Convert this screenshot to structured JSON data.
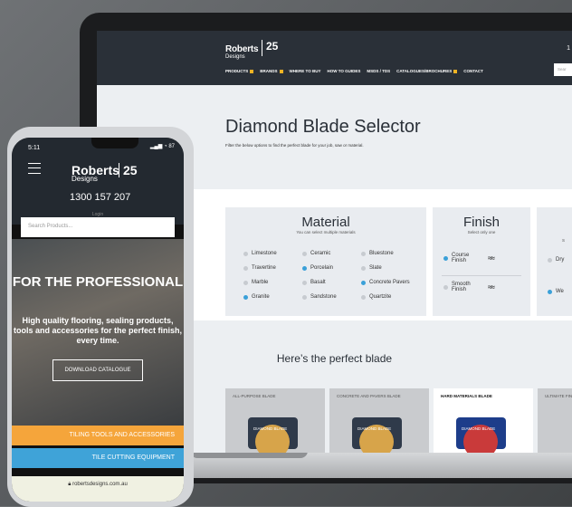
{
  "laptop": {
    "header": {
      "brand": "Roberts",
      "brand_sub": "Designs",
      "years": "25",
      "nav": [
        "PRODUCTS",
        "BRANDS",
        "WHERE TO BUY",
        "HOW TO GUIDES",
        "MSDS / TDS",
        "CATALOGUES/BROCHURES",
        "CONTACT"
      ],
      "search_placeholder": "Sear",
      "phone": "1"
    },
    "page_title": "Diamond Blade Selector",
    "page_subtitle": "Filter the below options to find the perfect blade for your job, saw or material.",
    "material": {
      "title": "Material",
      "hint": "You can select multiple materials",
      "options": [
        "Limestone",
        "Ceramic",
        "Bluestone",
        "Travertine",
        "Porcelain",
        "Slate",
        "Marble",
        "Basalt",
        "Concrete Pavers",
        "Granite",
        "Sandstone",
        "Quartzite"
      ]
    },
    "finish": {
      "title": "Finish",
      "hint": "Select only one",
      "options": [
        "Course Finish",
        "Smooth Finish"
      ]
    },
    "condition": {
      "hint": "S",
      "options": [
        "Dry",
        "We"
      ]
    },
    "results_title": "Here’s the perfect blade",
    "results": [
      "ALL-PURPOSE BLADE",
      "CONCRETE AND PAVERS BLADE",
      "HARD MATERIALS BLADE",
      "ULTIMATE FINISH BL"
    ],
    "blade_label": "DIAMOND BLADE"
  },
  "phone": {
    "time": "5:11",
    "battery": "87",
    "brand": "Roberts",
    "brand_sub": "Designs",
    "years": "25",
    "phone": "1300 157 207",
    "login": "Login",
    "search_placeholder": "Search Products...",
    "hero_title": "FOR THE PROFESSIONAL",
    "hero_text": "High quality flooring, sealing products, tools and accessories for the perfect finish, every time.",
    "button": "DOWNLOAD CATALOGUE",
    "bar1": "TILING TOOLS AND ACCESSORIES",
    "bar2": "TILE CUTTING EQUIPMENT",
    "url": "robertsdesigns.com.au"
  },
  "colors": {
    "accent_blue": "#3aa0d8",
    "accent_orange": "#f5a53b",
    "header_dark": "#2a3038"
  }
}
